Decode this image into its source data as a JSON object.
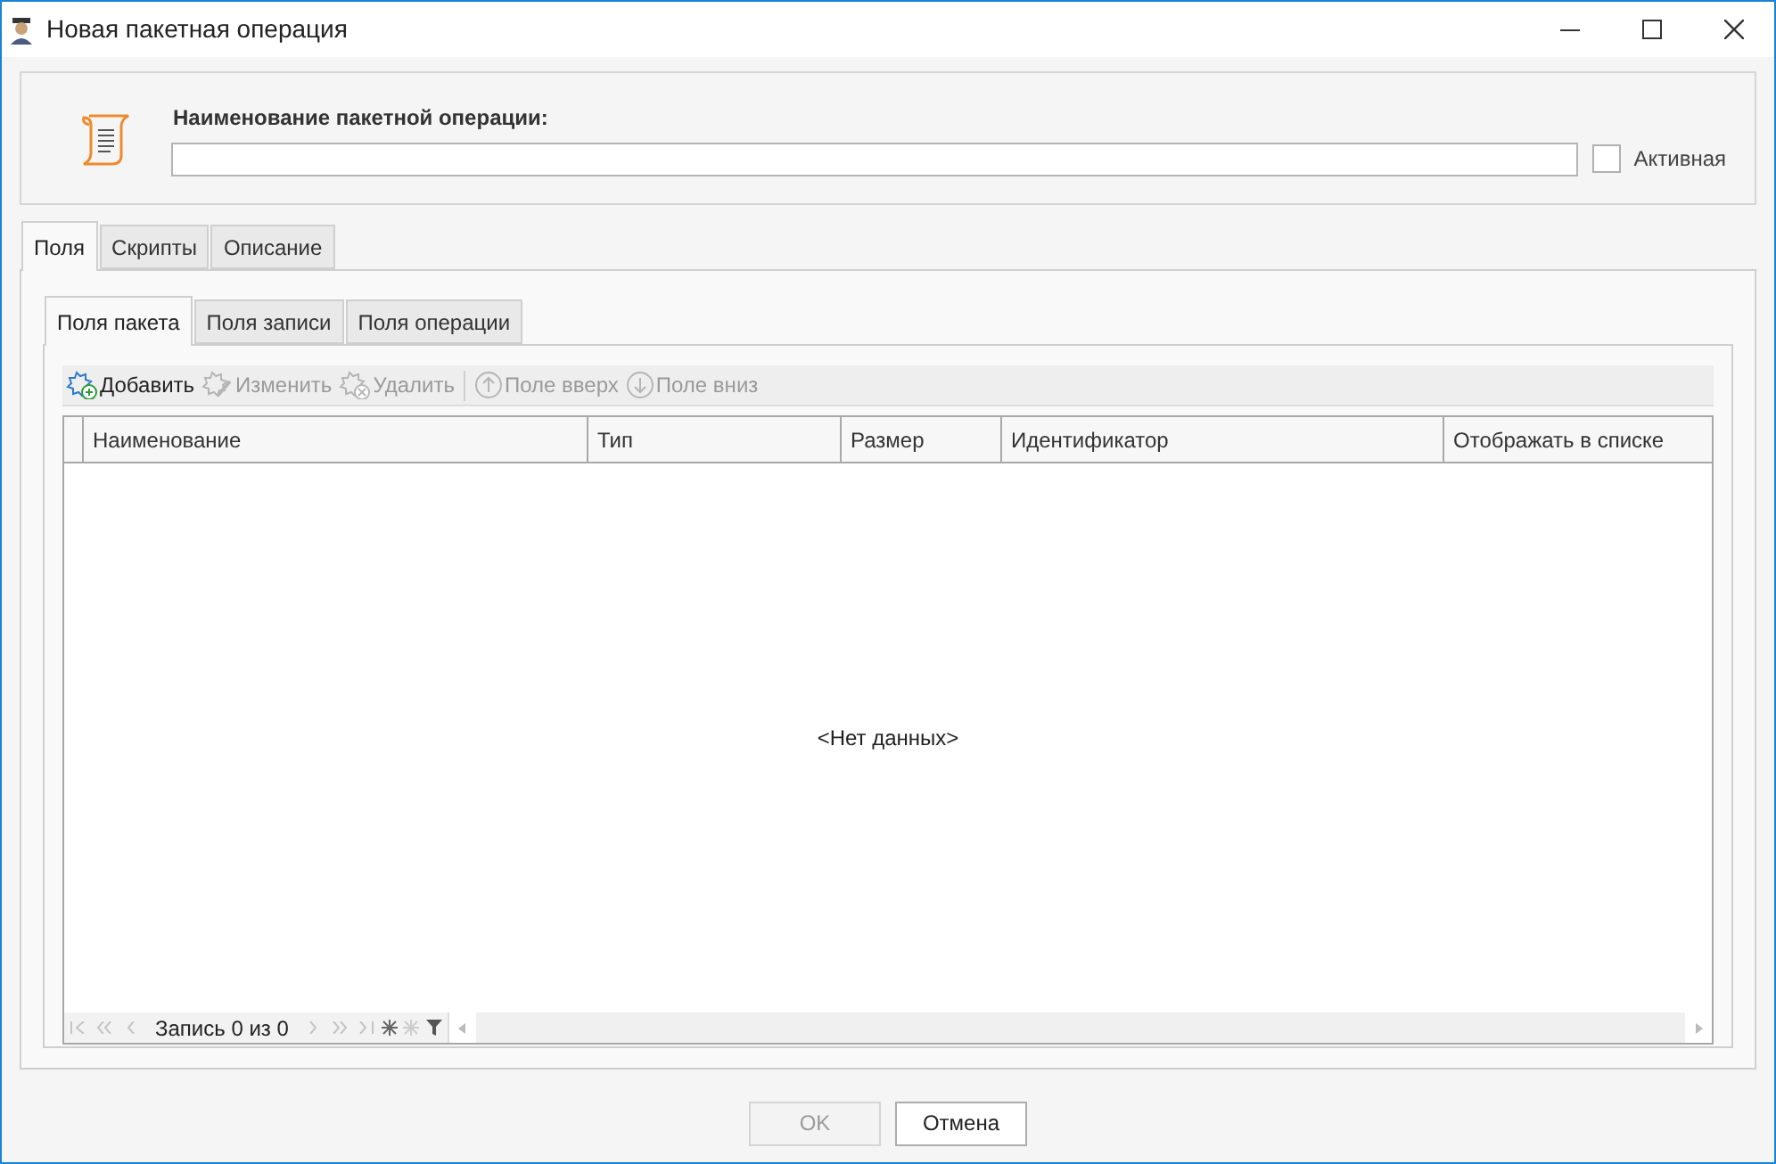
{
  "window": {
    "title": "Новая пакетная операция"
  },
  "header": {
    "label": "Наименование пакетной операции:",
    "active": {
      "label": "Активная",
      "checked": false
    }
  },
  "tabs": [
    {
      "label": "Поля",
      "selected": true
    },
    {
      "label": "Скрипты",
      "selected": false
    },
    {
      "label": "Описание",
      "selected": false
    }
  ],
  "subtabs": [
    {
      "label": "Поля пакета",
      "selected": true
    },
    {
      "label": "Поля записи",
      "selected": false
    },
    {
      "label": "Поля операции",
      "selected": false
    }
  ],
  "toolbar": [
    {
      "kind": "add",
      "label": "Добавить",
      "disabled": false
    },
    {
      "kind": "edit",
      "label": "Изменить",
      "disabled": true
    },
    {
      "kind": "delete",
      "label": "Удалить",
      "disabled": true
    },
    {
      "kind": "up",
      "label": "Поле вверх",
      "disabled": true
    },
    {
      "kind": "down",
      "label": "Поле вниз",
      "disabled": true
    }
  ],
  "table": {
    "columns": [
      "Наименование",
      "Тип",
      "Размер",
      "Идентификатор",
      "Отображать в списке"
    ],
    "empty_text": "<Нет данных>"
  },
  "navigator": {
    "record": "Запись 0 из 0"
  },
  "buttons": [
    {
      "label": "OK",
      "disabled": true
    },
    {
      "label": "Отмена",
      "disabled": false
    }
  ]
}
